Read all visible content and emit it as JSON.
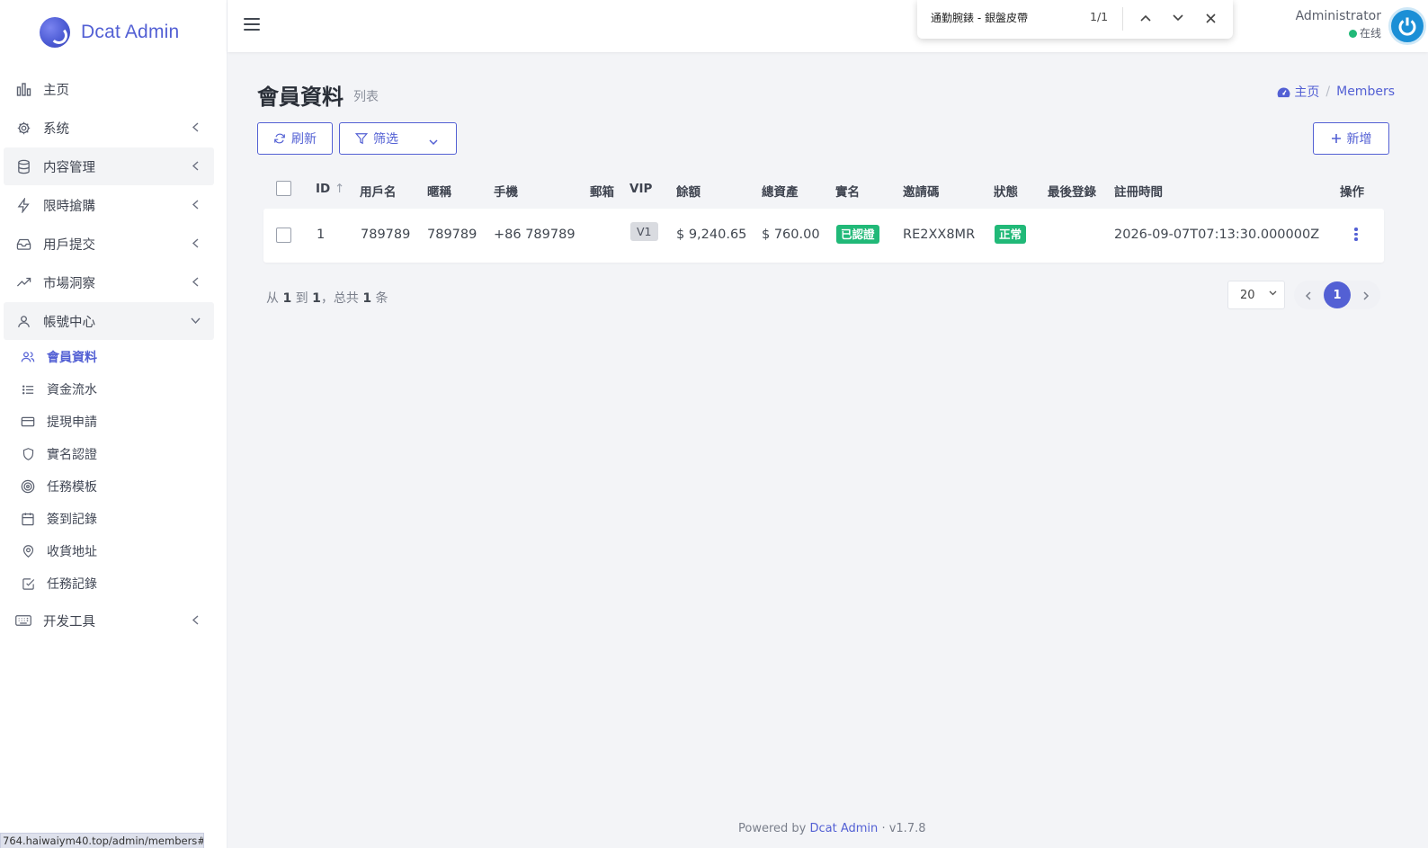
{
  "brand": {
    "name": "Dcat Admin"
  },
  "sidebar": {
    "items": [
      {
        "label": "主页",
        "icon": "bar-chart-icon",
        "expand": ""
      },
      {
        "label": "系统",
        "icon": "gear-icon",
        "expand": "left"
      },
      {
        "label": "内容管理",
        "icon": "database-icon",
        "expand": "left",
        "active": true
      },
      {
        "label": "限時搶購",
        "icon": "lightning-icon",
        "expand": "left"
      },
      {
        "label": "用戶提交",
        "icon": "inbox-icon",
        "expand": "left"
      },
      {
        "label": "市場洞察",
        "icon": "trending-up-icon",
        "expand": "left"
      },
      {
        "label": "帳號中心",
        "icon": "user-icon",
        "expand": "down",
        "active": true
      },
      {
        "label": "开发工具",
        "icon": "keyboard-icon",
        "expand": "left"
      }
    ],
    "submenu": [
      {
        "label": "會員資料",
        "icon": "users-icon",
        "current": true
      },
      {
        "label": "資金流水",
        "icon": "list-icon"
      },
      {
        "label": "提現申請",
        "icon": "credit-card-icon"
      },
      {
        "label": "實名認證",
        "icon": "shield-icon"
      },
      {
        "label": "任務模板",
        "icon": "target-icon"
      },
      {
        "label": "簽到記錄",
        "icon": "calendar-icon"
      },
      {
        "label": "收貨地址",
        "icon": "map-pin-icon"
      },
      {
        "label": "任務記錄",
        "icon": "check-square-icon"
      }
    ]
  },
  "status_url": "764.haiwaiym40.top/admin/members#",
  "find_bar": {
    "query": "通勤腕錶 - 銀盤皮帶",
    "count": "1/1"
  },
  "user": {
    "name": "Administrator",
    "status": "在线"
  },
  "page": {
    "title": "會員資料",
    "subtitle": "列表"
  },
  "breadcrumb": {
    "home": "主页",
    "separator": "/",
    "current": "Members"
  },
  "toolbar": {
    "refresh": "刷新",
    "filter": "筛选",
    "create": "新增"
  },
  "table": {
    "headers": {
      "id": "ID",
      "username": "用戶名",
      "nickname": "暱稱",
      "phone": "手機",
      "email": "郵箱",
      "vip": "VIP",
      "balance": "餘額",
      "total_assets": "總資產",
      "realname": "實名",
      "invite_code": "邀請碼",
      "status": "狀態",
      "last_login": "最後登錄",
      "registered": "註冊時間",
      "actions": "操作"
    },
    "rows": [
      {
        "id": "1",
        "username": "789789",
        "nickname": "789789",
        "phone": "+86 789789",
        "email": "",
        "vip": "V1",
        "balance": "$ 9,240.65",
        "total_assets": "$ 760.00",
        "realname": "已認證",
        "invite_code": "RE2XX8MR",
        "status": "正常",
        "last_login": "",
        "registered": "2026-09-07T07:13:30.000000Z"
      }
    ]
  },
  "pagination": {
    "prefix": "从",
    "from": "1",
    "to_word": "到",
    "to": "1",
    "total_word": "，总共",
    "total": "1",
    "unit": "条",
    "per_page": "20",
    "current_page": "1"
  },
  "footer": {
    "powered_by": "Powered by",
    "link": "Dcat Admin",
    "dot": "·",
    "version": "v1.7.8"
  },
  "colors": {
    "primary": "#5360d4",
    "success": "#21b978",
    "sidebar_bg": "#ffffff",
    "content_bg": "#f3f4f7"
  }
}
